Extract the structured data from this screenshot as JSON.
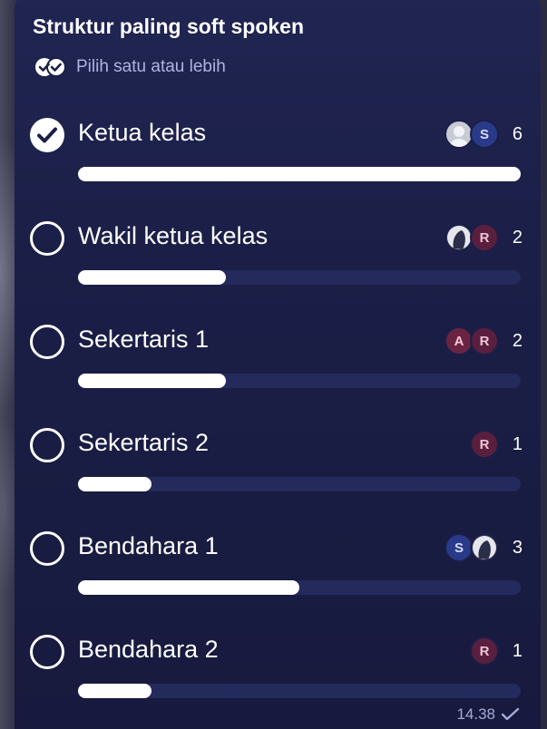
{
  "poll": {
    "title": "Struktur paling soft spoken",
    "subtitle": "Pilih satu atau lebih",
    "subtitle_icon": "double-check-icon",
    "options": [
      {
        "label": "Ketua kelas",
        "selected": true,
        "count": "6",
        "fraction": 1.0,
        "voters": [
          {
            "type": "photo",
            "style": "photo-gray"
          },
          {
            "type": "initial",
            "letter": "S",
            "style": "s"
          }
        ]
      },
      {
        "label": "Wakil ketua kelas",
        "selected": false,
        "count": "2",
        "fraction": 0.333,
        "voters": [
          {
            "type": "photo",
            "style": "photo-dark"
          },
          {
            "type": "initial",
            "letter": "R",
            "style": "r"
          }
        ]
      },
      {
        "label": "Sekertaris 1",
        "selected": false,
        "count": "2",
        "fraction": 0.333,
        "voters": [
          {
            "type": "initial",
            "letter": "A",
            "style": "a"
          },
          {
            "type": "initial",
            "letter": "R",
            "style": "r"
          }
        ]
      },
      {
        "label": "Sekertaris 2",
        "selected": false,
        "count": "1",
        "fraction": 0.167,
        "voters": [
          {
            "type": "initial",
            "letter": "R",
            "style": "r"
          }
        ]
      },
      {
        "label": "Bendahara 1",
        "selected": false,
        "count": "3",
        "fraction": 0.5,
        "voters": [
          {
            "type": "initial",
            "letter": "S",
            "style": "s"
          },
          {
            "type": "photo",
            "style": "photo-dark"
          }
        ]
      },
      {
        "label": "Bendahara 2",
        "selected": false,
        "count": "1",
        "fraction": 0.167,
        "voters": [
          {
            "type": "initial",
            "letter": "R",
            "style": "r"
          }
        ]
      }
    ]
  },
  "message": {
    "time": "14.38",
    "status_icon": "sent-check-icon"
  },
  "colors": {
    "bubble": "#1b1f47",
    "bar_track": "#242a5c",
    "bar_fill": "#ffffff",
    "subtitle": "#aeb3e0"
  }
}
